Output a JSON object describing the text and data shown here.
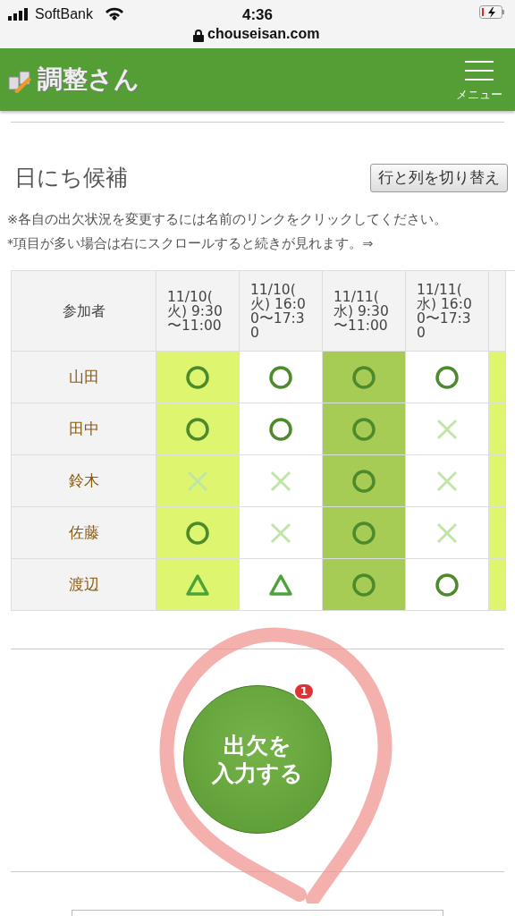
{
  "status_bar": {
    "carrier": "SoftBank",
    "time": "4:36",
    "url": "chouseisan.com",
    "battery_charging": true
  },
  "header": {
    "logo": "調整さん",
    "menu_label": "メニュー"
  },
  "section": {
    "title": "日にち候補",
    "toggle_button": "行と列を切り替え",
    "notes": [
      "※各自の出欠状況を変更するには名前のリンクをクリックしてください。",
      "*項目が多い場合は右にスクロールすると続きが見れます。⇒"
    ]
  },
  "table": {
    "participant_header": "参加者",
    "columns": [
      {
        "label": "11/10(\n火) 9:30\n〜11:00",
        "color": "#ddf56f"
      },
      {
        "label": "11/10(\n火) 16:0\n0〜17:3\n0",
        "color": "#ffffff"
      },
      {
        "label": "11/11(\n水) 9:30\n〜11:00",
        "color": "#a6cc55"
      },
      {
        "label": "11/11(\n水) 16:0\n0〜17:3\n0",
        "color": "#ffffff"
      },
      {
        "color": "#ddf56f"
      }
    ],
    "rows": [
      {
        "name": "山田",
        "answers": [
          {
            "kind": "circle"
          },
          {
            "kind": "circle"
          },
          {
            "kind": "circle"
          },
          {
            "kind": "circle"
          }
        ]
      },
      {
        "name": "田中",
        "answers": [
          {
            "kind": "circle"
          },
          {
            "kind": "circle"
          },
          {
            "kind": "circle"
          },
          {
            "kind": "cross"
          }
        ]
      },
      {
        "name": "鈴木",
        "answers": [
          {
            "kind": "cross"
          },
          {
            "kind": "cross"
          },
          {
            "kind": "circle"
          },
          {
            "kind": "cross"
          }
        ]
      },
      {
        "name": "佐藤",
        "answers": [
          {
            "kind": "circle"
          },
          {
            "kind": "cross"
          },
          {
            "kind": "circle"
          },
          {
            "kind": "cross"
          }
        ]
      },
      {
        "name": "渡辺",
        "answers": [
          {
            "kind": "triangle"
          },
          {
            "kind": "triangle"
          },
          {
            "kind": "circle"
          },
          {
            "kind": "circle"
          }
        ]
      }
    ]
  },
  "answer_button": {
    "label_lines": [
      "出欠を",
      "入力する"
    ],
    "badge": "1"
  },
  "annotation": {
    "kind": "circle"
  }
}
